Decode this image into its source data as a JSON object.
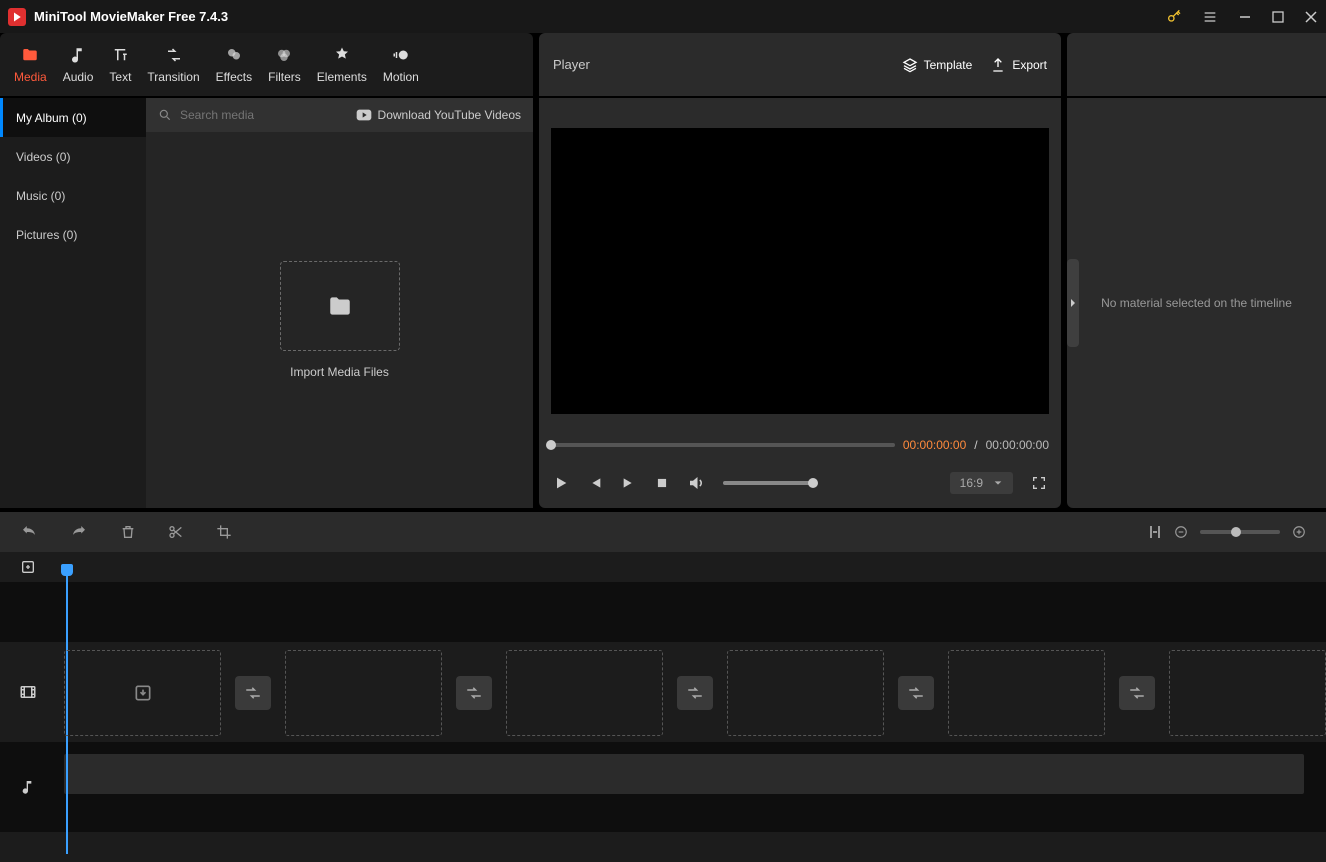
{
  "app": {
    "title": "MiniTool MovieMaker Free 7.4.3"
  },
  "tabs": {
    "media": "Media",
    "audio": "Audio",
    "text": "Text",
    "transition": "Transition",
    "effects": "Effects",
    "filters": "Filters",
    "elements": "Elements",
    "motion": "Motion"
  },
  "library": {
    "items": {
      "album": "My Album (0)",
      "videos": "Videos (0)",
      "music": "Music (0)",
      "pictures": "Pictures (0)"
    },
    "search_placeholder": "Search media",
    "download_label": "Download YouTube Videos",
    "import_label": "Import Media Files"
  },
  "player": {
    "label": "Player",
    "template": "Template",
    "export": "Export",
    "current": "00:00:00:00",
    "sep": "/",
    "duration": "00:00:00:00",
    "aspect": "16:9"
  },
  "properties": {
    "empty": "No material selected on the timeline"
  }
}
